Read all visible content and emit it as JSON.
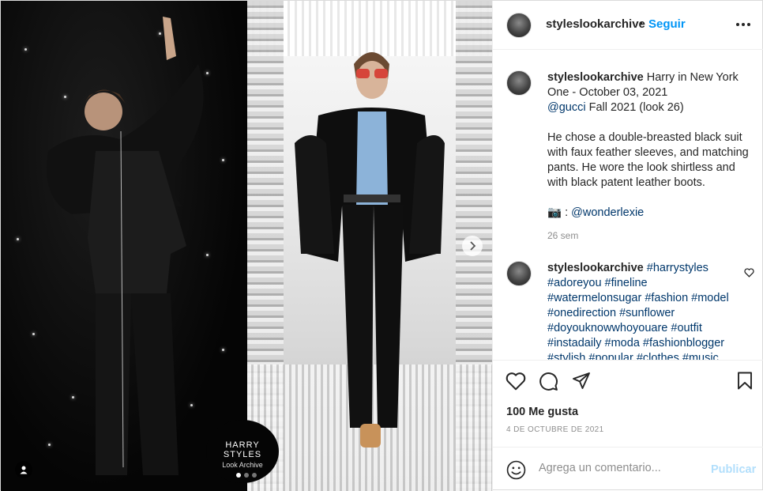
{
  "media": {
    "badge_line1": "HARRY STYLES",
    "badge_line2": "Look Archive",
    "carousel_count": 3,
    "carousel_active": 0
  },
  "header": {
    "username": "styleslookarchive",
    "separator": "•",
    "follow_label": "Seguir"
  },
  "caption": {
    "username": "styleslookarchive",
    "line1": "Harry in New York One - October 03, 2021",
    "mention": "@gucci",
    "line2": "Fall 2021 (look 26)",
    "paragraph": "He chose a double-breasted black suit with faux feather sleeves, and matching pants. He wore the look shirtless and with black patent leather boots.",
    "credit_prefix": "📷 : ",
    "credit_handle": "@wonderlexie",
    "time": "26 sem"
  },
  "comment": {
    "username": "styleslookarchive",
    "hashtags": "#harrystyles #adoreyou #fineline #watermelonsugar #fashion #model #onedirection #sunflower #doyouknowwhoyouare #outfit #instadaily #moda #fashionblogger #stylish #popular #clothes #music"
  },
  "actions": {
    "likes": "100 Me gusta",
    "date": "4 DE OCTUBRE DE 2021"
  },
  "composer": {
    "placeholder": "Agrega un comentario...",
    "publish_label": "Publicar"
  },
  "colors": {
    "accent": "#0095f6",
    "link": "#00376b",
    "muted": "#8e8e8e",
    "publish_disabled": "#b2dffc"
  }
}
